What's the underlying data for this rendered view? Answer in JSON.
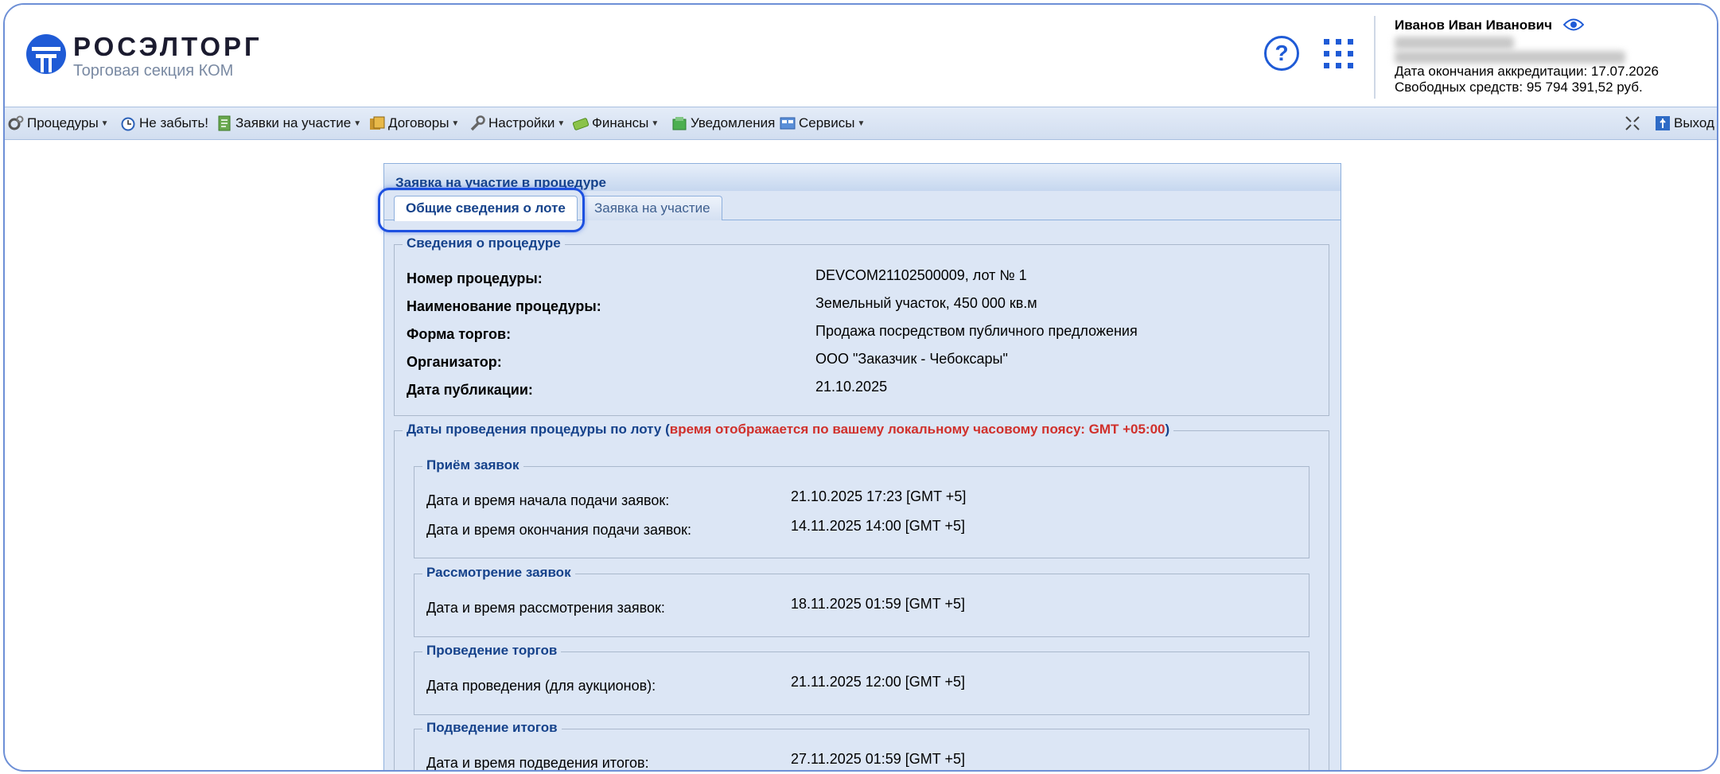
{
  "header": {
    "logo_name": "РОСЭЛТОРГ",
    "logo_subtitle": "Торговая секция КОМ",
    "help_symbol": "?",
    "icons": [
      "logo-icon",
      "help-icon",
      "apps-grid-icon",
      "eye-icon"
    ],
    "user": {
      "name": "Иванов Иван Иванович",
      "accreditation_line": "Дата окончания аккредитации: 17.07.2026",
      "funds_line": "Свободных средств: 95 794 391,52 руб."
    }
  },
  "menu": {
    "items": [
      {
        "label": "Процедуры",
        "icon": "gears-icon"
      },
      {
        "label": "Не забыть!",
        "icon": "alarm-clock-icon"
      },
      {
        "label": "Заявки на участие",
        "icon": "document-icon"
      },
      {
        "label": "Договоры",
        "icon": "contracts-icon"
      },
      {
        "label": "Настройки",
        "icon": "wrench-icon"
      },
      {
        "label": "Финансы",
        "icon": "money-icon"
      },
      {
        "label": "Уведомления",
        "icon": "notification-icon"
      },
      {
        "label": "Сервисы",
        "icon": "services-icon"
      }
    ],
    "exit_label": "Выход"
  },
  "panel": {
    "title": "Заявка на участие в процедуре",
    "tabs": [
      {
        "label": "Общие сведения о лоте",
        "active": true
      },
      {
        "label": "Заявка на участие",
        "active": false
      }
    ],
    "procedure_info": {
      "legend": "Сведения о процедуре",
      "rows": [
        {
          "label": "Номер процедуры:",
          "value": "DEVCOM21102500009, лот № 1"
        },
        {
          "label": "Наименование процедуры:",
          "value": "Земельный участок, 450 000 кв.м"
        },
        {
          "label": "Форма торгов:",
          "value": "Продажа посредством публичного предложения"
        },
        {
          "label": "Организатор:",
          "value": "ООО \"Заказчик - Чебоксары\""
        },
        {
          "label": "Дата публикации:",
          "value": "21.10.2025"
        }
      ]
    },
    "dates": {
      "legend_prefix": "Даты проведения процедуры по лоту (",
      "legend_warning": "время отображается по вашему локальному часовому поясу: GMT +05:00",
      "legend_suffix": ")",
      "groups": [
        {
          "legend": "Приём заявок",
          "rows": [
            {
              "label": "Дата и время начала подачи заявок:",
              "value": "21.10.2025 17:23 [GMT +5]"
            },
            {
              "label": "Дата и время окончания подачи заявок:",
              "value": "14.11.2025 14:00 [GMT +5]"
            }
          ]
        },
        {
          "legend": "Рассмотрение заявок",
          "rows": [
            {
              "label": "Дата и время рассмотрения заявок:",
              "value": "18.11.2025 01:59 [GMT +5]"
            }
          ]
        },
        {
          "legend": "Проведение торгов",
          "rows": [
            {
              "label": "Дата проведения (для аукционов):",
              "value": "21.11.2025 12:00 [GMT +5]"
            }
          ]
        },
        {
          "legend": "Подведение итогов",
          "rows": [
            {
              "label": "Дата и время подведения итогов:",
              "value": "27.11.2025 01:59 [GMT +5]"
            }
          ]
        }
      ]
    }
  },
  "colors": {
    "brand_blue": "#1f5bd6",
    "panel_bg": "#dce6f5",
    "legend_blue": "#15428b",
    "warning_red": "#d0302b"
  }
}
